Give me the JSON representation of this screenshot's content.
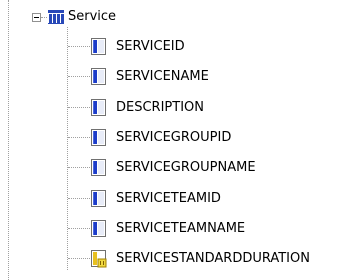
{
  "tree": {
    "root": {
      "label": "Service",
      "icon": "table-icon",
      "expanded": true
    },
    "children": [
      {
        "label": "SERVICEID",
        "icon": "field-icon"
      },
      {
        "label": "SERVICENAME",
        "icon": "field-icon"
      },
      {
        "label": "DESCRIPTION",
        "icon": "field-icon"
      },
      {
        "label": "SERVICEGROUPID",
        "icon": "field-icon"
      },
      {
        "label": "SERVICEGROUPNAME",
        "icon": "field-icon"
      },
      {
        "label": "SERVICETEAMID",
        "icon": "field-icon"
      },
      {
        "label": "SERVICETEAMNAME",
        "icon": "field-icon"
      },
      {
        "label": "SERVICESTANDARDDURATION",
        "icon": "numeric-field-icon"
      }
    ]
  },
  "colors": {
    "connector": "#a0a0a0",
    "field_icon_blue": "#1c3cc8",
    "table_icon_blue": "#2848b8",
    "numeric_icon_yellow": "#e8c020"
  }
}
